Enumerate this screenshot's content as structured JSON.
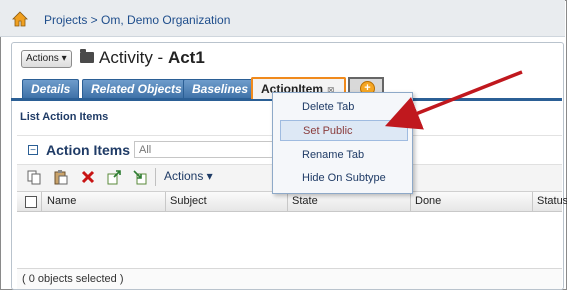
{
  "breadcrumb": {
    "text": "Projects > Om, Demo Organization"
  },
  "header": {
    "actions_label": "Actions ▾",
    "title_prefix": "Activity - ",
    "title_name": "Act1"
  },
  "tabs": [
    {
      "label": "Details"
    },
    {
      "label": "Related Objects"
    },
    {
      "label": "Baselines"
    },
    {
      "label": "ActionItem",
      "close": "⊠"
    }
  ],
  "section": {
    "title": "List Action Items"
  },
  "action_items": {
    "collapse": "−",
    "title": "Action Items",
    "filter_value": "All"
  },
  "toolbar": {
    "actions_label": "Actions ▾",
    "icons": [
      "copy-icon",
      "paste-icon",
      "delete-icon",
      "export-icon",
      "import-icon"
    ]
  },
  "table": {
    "columns": [
      "Name",
      "Subject",
      "State",
      "Done",
      "Status"
    ]
  },
  "footer": {
    "selection": "( 0 objects selected )"
  },
  "context_menu": {
    "items": [
      "Delete Tab",
      "Set Public",
      "Rename Tab",
      "Hide On Subtype"
    ]
  },
  "colors": {
    "accent": "#2b5f95",
    "active_tab_border": "#f08a1c",
    "arrow": "#c0181e"
  }
}
